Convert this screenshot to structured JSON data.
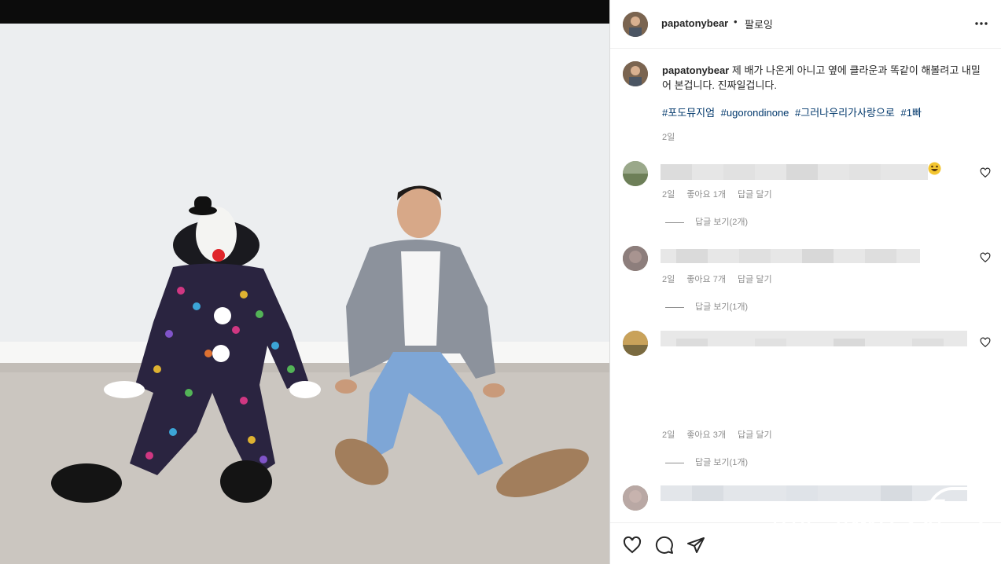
{
  "post": {
    "username": "papatonybear",
    "separator": "•",
    "follow_label": "팔로잉",
    "caption_text": "제 배가 나온게 아니고 옆에 클라운과 똑같이 해볼려고 내밀어 본겁니다. 진짜일겁니다.",
    "hashtags": [
      "#포도뮤지엄",
      "#ugorondinone",
      "#그러나우리가사랑으로",
      "#1빠"
    ],
    "time": "2일"
  },
  "comments": [
    {
      "time": "2일",
      "likes": "좋아요 1개",
      "reply_label": "답글 달기",
      "view_replies": "답글 보기(2개)"
    },
    {
      "time": "2일",
      "likes": "좋아요 7개",
      "reply_label": "답글 달기",
      "view_replies": "답글 보기(1개)"
    },
    {
      "time": "2일",
      "likes": "좋아요 3개",
      "reply_label": "답글 달기",
      "view_replies": "답글 보기(1개)"
    }
  ],
  "icons": {
    "more": "more-dots-icon",
    "like": "heart-icon",
    "comment": "comment-icon",
    "share": "share-icon",
    "emoji": "laughing-emoji-icon"
  },
  "watermark": "news1",
  "colors": {
    "hashtag": "#00376b",
    "meta": "#8e8e8e",
    "text": "#262626"
  }
}
